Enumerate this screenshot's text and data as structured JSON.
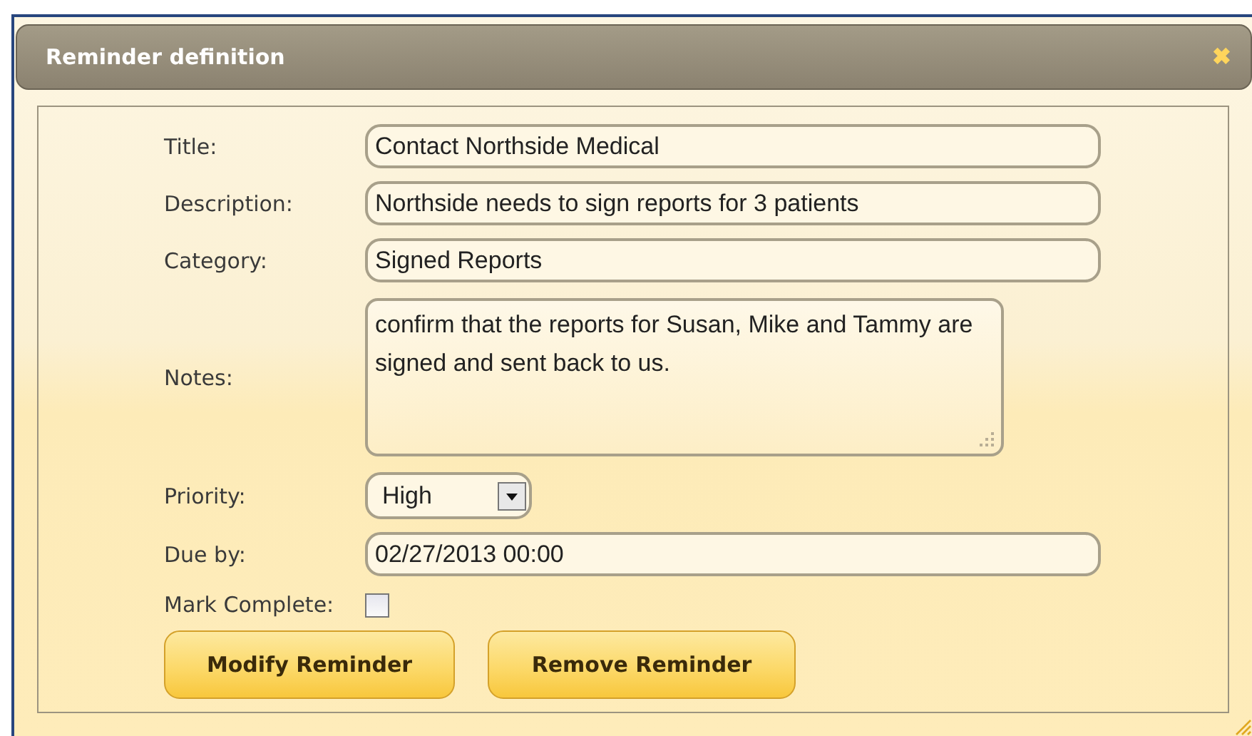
{
  "dialog": {
    "title": "Reminder definition",
    "close": "✖"
  },
  "fields": [
    {
      "kind": "text",
      "label": "Title:",
      "value": "Contact Northside Medical"
    },
    {
      "kind": "text",
      "label": "Description:",
      "value": "Northside needs to sign reports for 3 patients"
    },
    {
      "kind": "text",
      "label": "Category:",
      "value": "Signed Reports"
    },
    {
      "kind": "textarea",
      "label": "Notes:",
      "value": "confirm that the reports for Susan, Mike and Tammy are signed and sent back to us."
    },
    {
      "kind": "select",
      "label": "Priority:",
      "value": "High"
    },
    {
      "kind": "text",
      "label": "Due by:",
      "value": "02/27/2013 00:00"
    },
    {
      "kind": "checkbox",
      "label": "Mark Complete:",
      "checked": false
    }
  ],
  "buttons": [
    "Modify Reminder",
    "Remove Reminder"
  ]
}
